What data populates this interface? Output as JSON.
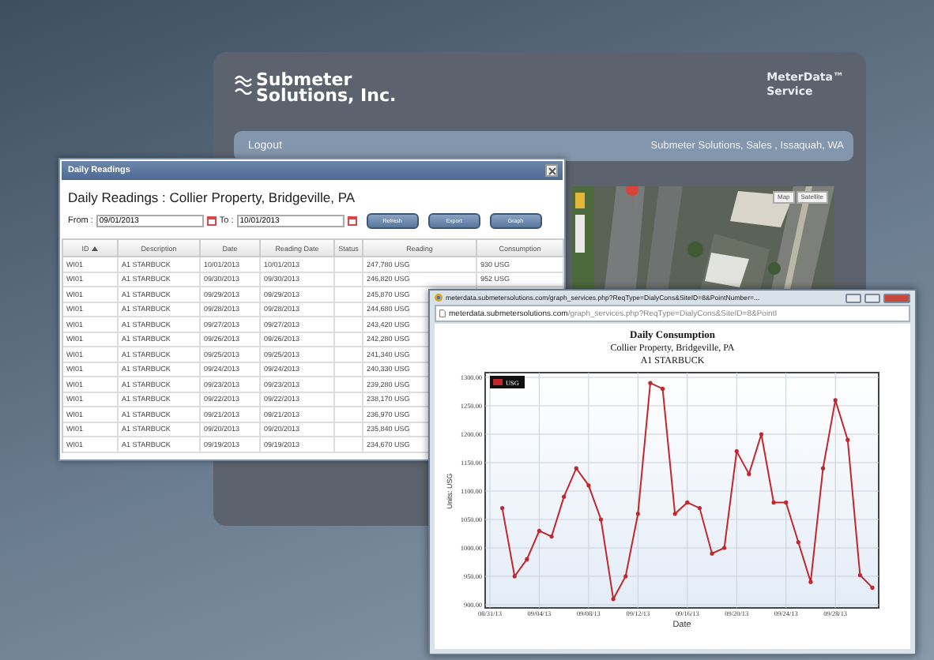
{
  "app": {
    "logo_lines": [
      "Submeter",
      "Solutions, Inc."
    ],
    "service_lines": [
      "MeterData™",
      "Service"
    ],
    "nav": {
      "logout": "Logout",
      "location": "Submeter Solutions, Sales , Issaquah, WA"
    },
    "map": {
      "kind": "picture",
      "buttons": [
        "Map",
        "Satellite"
      ]
    }
  },
  "readings_window": {
    "title": "Daily Readings",
    "heading": "Daily Readings : Collier Property, Bridgeville, PA",
    "from_label": "From :",
    "from": "09/01/2013",
    "to_label": "To :",
    "to": "10/01/2013",
    "buttons": [
      "Refresh",
      "Export",
      "Graph"
    ],
    "columns": [
      {
        "label": "ID",
        "sorted": true
      },
      {
        "label": "Description",
        "sorted": false
      },
      {
        "label": "Date",
        "sorted": false
      },
      {
        "label": "Reading Date",
        "sorted": false
      },
      {
        "label": "Status",
        "sorted": false
      },
      {
        "label": "Reading",
        "sorted": false
      },
      {
        "label": "Consumption",
        "sorted": false
      }
    ],
    "rows": [
      {
        "id": "WI01",
        "description": "A1 STARBUCK",
        "date": "10/01/2013",
        "reading_date": "10/01/2013",
        "reading": "247,780 USG",
        "consumption": "930 USG"
      },
      {
        "id": "WI01",
        "description": "A1 STARBUCK",
        "date": "09/30/2013",
        "reading_date": "09/30/2013",
        "reading": "246,820 USG",
        "consumption": "952 USG"
      },
      {
        "id": "WI01",
        "description": "A1 STARBUCK",
        "date": "09/29/2013",
        "reading_date": "09/29/2013",
        "reading": "245,870 USG"
      },
      {
        "id": "WI01",
        "description": "A1 STARBUCK",
        "date": "09/28/2013",
        "reading_date": "09/28/2013",
        "reading": "244,680 USG"
      },
      {
        "id": "WI01",
        "description": "A1 STARBUCK",
        "date": "09/27/2013",
        "reading_date": "09/27/2013",
        "reading": "243,420 USG"
      },
      {
        "id": "WI01",
        "description": "A1 STARBUCK",
        "date": "09/26/2013",
        "reading_date": "09/26/2013",
        "reading": "242,280 USG"
      },
      {
        "id": "WI01",
        "description": "A1 STARBUCK",
        "date": "09/25/2013",
        "reading_date": "09/25/2013",
        "reading": "241,340 USG"
      },
      {
        "id": "WI01",
        "description": "A1 STARBUCK",
        "date": "09/24/2013",
        "reading_date": "09/24/2013",
        "reading": "240,330 USG"
      },
      {
        "id": "WI01",
        "description": "A1 STARBUCK",
        "date": "09/23/2013",
        "reading_date": "09/23/2013",
        "reading": "239,280 USG"
      },
      {
        "id": "WI01",
        "description": "A1 STARBUCK",
        "date": "09/22/2013",
        "reading_date": "09/22/2013",
        "reading": "238,170 USG"
      },
      {
        "id": "WI01",
        "description": "A1 STARBUCK",
        "date": "09/21/2013",
        "reading_date": "09/21/2013",
        "reading": "236,970 USG"
      },
      {
        "id": "WI01",
        "description": "A1 STARBUCK",
        "date": "09/20/2013",
        "reading_date": "09/20/2013",
        "reading": "235,840 USG"
      },
      {
        "id": "WI01",
        "description": "A1 STARBUCK",
        "date": "09/19/2013",
        "reading_date": "09/19/2013",
        "reading": "234,670 USG"
      }
    ]
  },
  "graph_window": {
    "title": "meterdata.submetersolutions.com/graph_services.php?ReqType=DialyCons&SiteID=8&PointNumber=...",
    "url_domain": "meterdata.submetersolutions.com",
    "url_path": "/graph_services.php?ReqType=DialyCons&SiteID=8&PointI",
    "titles": [
      "Daily Consumption",
      "Collier Property, Bridgeville, PA",
      "A1 STARBUCK"
    ],
    "chart_data": {
      "type": "line",
      "grid": true,
      "xlabel": "Date",
      "ylabel": "Units: USG",
      "ylim": [
        900,
        1300
      ],
      "yticks": [
        {
          "value": 900,
          "label": "900.00"
        },
        {
          "value": 950,
          "label": "950.00"
        },
        {
          "value": 1000,
          "label": "1000.00"
        },
        {
          "value": 1050,
          "label": "1050.00"
        },
        {
          "value": 1100,
          "label": "1100.00"
        },
        {
          "value": 1150,
          "label": "1150.00"
        },
        {
          "value": 1200,
          "label": "1200.00"
        },
        {
          "value": 1250,
          "label": "1250.00"
        },
        {
          "value": 1300,
          "label": "1300.00"
        }
      ],
      "categories": [
        "08/31/13",
        null,
        null,
        null,
        "09/04/13",
        null,
        null,
        null,
        "09/08/13",
        null,
        null,
        null,
        "09/12/13",
        null,
        null,
        null,
        "09/16/13",
        null,
        null,
        null,
        "09/20/13",
        null,
        null,
        null,
        "09/24/13",
        null,
        null,
        null,
        "09/28/13",
        null,
        null,
        null
      ],
      "series": [
        {
          "name": "USG",
          "color": "#c0282d",
          "values": [
            null,
            1070,
            950,
            980,
            1030,
            1020,
            1090,
            1140,
            1110,
            1050,
            910,
            950,
            1060,
            1290,
            1280,
            1060,
            1080,
            1070,
            990,
            1000,
            1170,
            1130,
            1200,
            1080,
            1080,
            1010,
            940,
            1140,
            1260,
            1190,
            952,
            930
          ]
        }
      ]
    }
  }
}
